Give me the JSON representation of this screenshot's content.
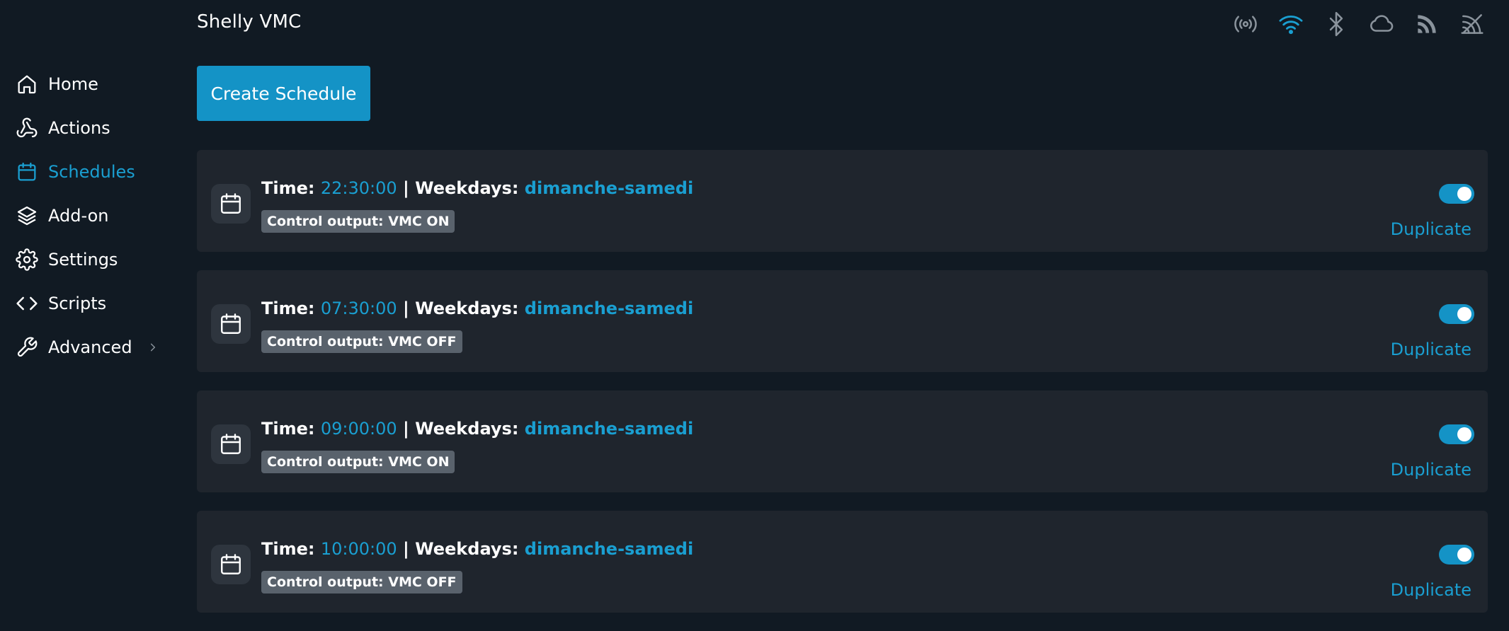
{
  "header": {
    "device_name": "Shelly VMC",
    "status_icons": [
      "broadcast-icon",
      "wifi-icon",
      "bluetooth-icon",
      "cloud-icon",
      "rss-icon",
      "mqtt-off-icon"
    ]
  },
  "sidebar": {
    "items": [
      {
        "label": "Home",
        "icon": "home-icon"
      },
      {
        "label": "Actions",
        "icon": "webhook-icon"
      },
      {
        "label": "Schedules",
        "icon": "calendar-icon",
        "active": true
      },
      {
        "label": "Add-on",
        "icon": "layers-icon"
      },
      {
        "label": "Settings",
        "icon": "gear-icon"
      },
      {
        "label": "Scripts",
        "icon": "code-icon"
      },
      {
        "label": "Advanced",
        "icon": "wrench-icon",
        "has_submenu": true
      }
    ]
  },
  "main": {
    "create_button_label": "Create Schedule",
    "schedules": [
      {
        "time_label": "Time:",
        "time": "22:30:00",
        "separator": "|",
        "weekdays_label": "Weekdays:",
        "weekdays": "dimanche-samedi",
        "action": "Control output: VMC ON",
        "enabled": true,
        "duplicate_label": "Duplicate"
      },
      {
        "time_label": "Time:",
        "time": "07:30:00",
        "separator": "|",
        "weekdays_label": "Weekdays:",
        "weekdays": "dimanche-samedi",
        "action": "Control output: VMC OFF",
        "enabled": true,
        "duplicate_label": "Duplicate"
      },
      {
        "time_label": "Time:",
        "time": "09:00:00",
        "separator": "|",
        "weekdays_label": "Weekdays:",
        "weekdays": "dimanche-samedi",
        "action": "Control output: VMC ON",
        "enabled": true,
        "duplicate_label": "Duplicate"
      },
      {
        "time_label": "Time:",
        "time": "10:00:00",
        "separator": "|",
        "weekdays_label": "Weekdays:",
        "weekdays": "dimanche-samedi",
        "action": "Control output: VMC OFF",
        "enabled": true,
        "duplicate_label": "Duplicate"
      }
    ]
  },
  "colors": {
    "background": "#111a23",
    "card": "#1f252d",
    "accent": "#1a9fd1",
    "button": "#1493c6",
    "badge": "#59626c",
    "icon_inactive": "#8a939c"
  }
}
